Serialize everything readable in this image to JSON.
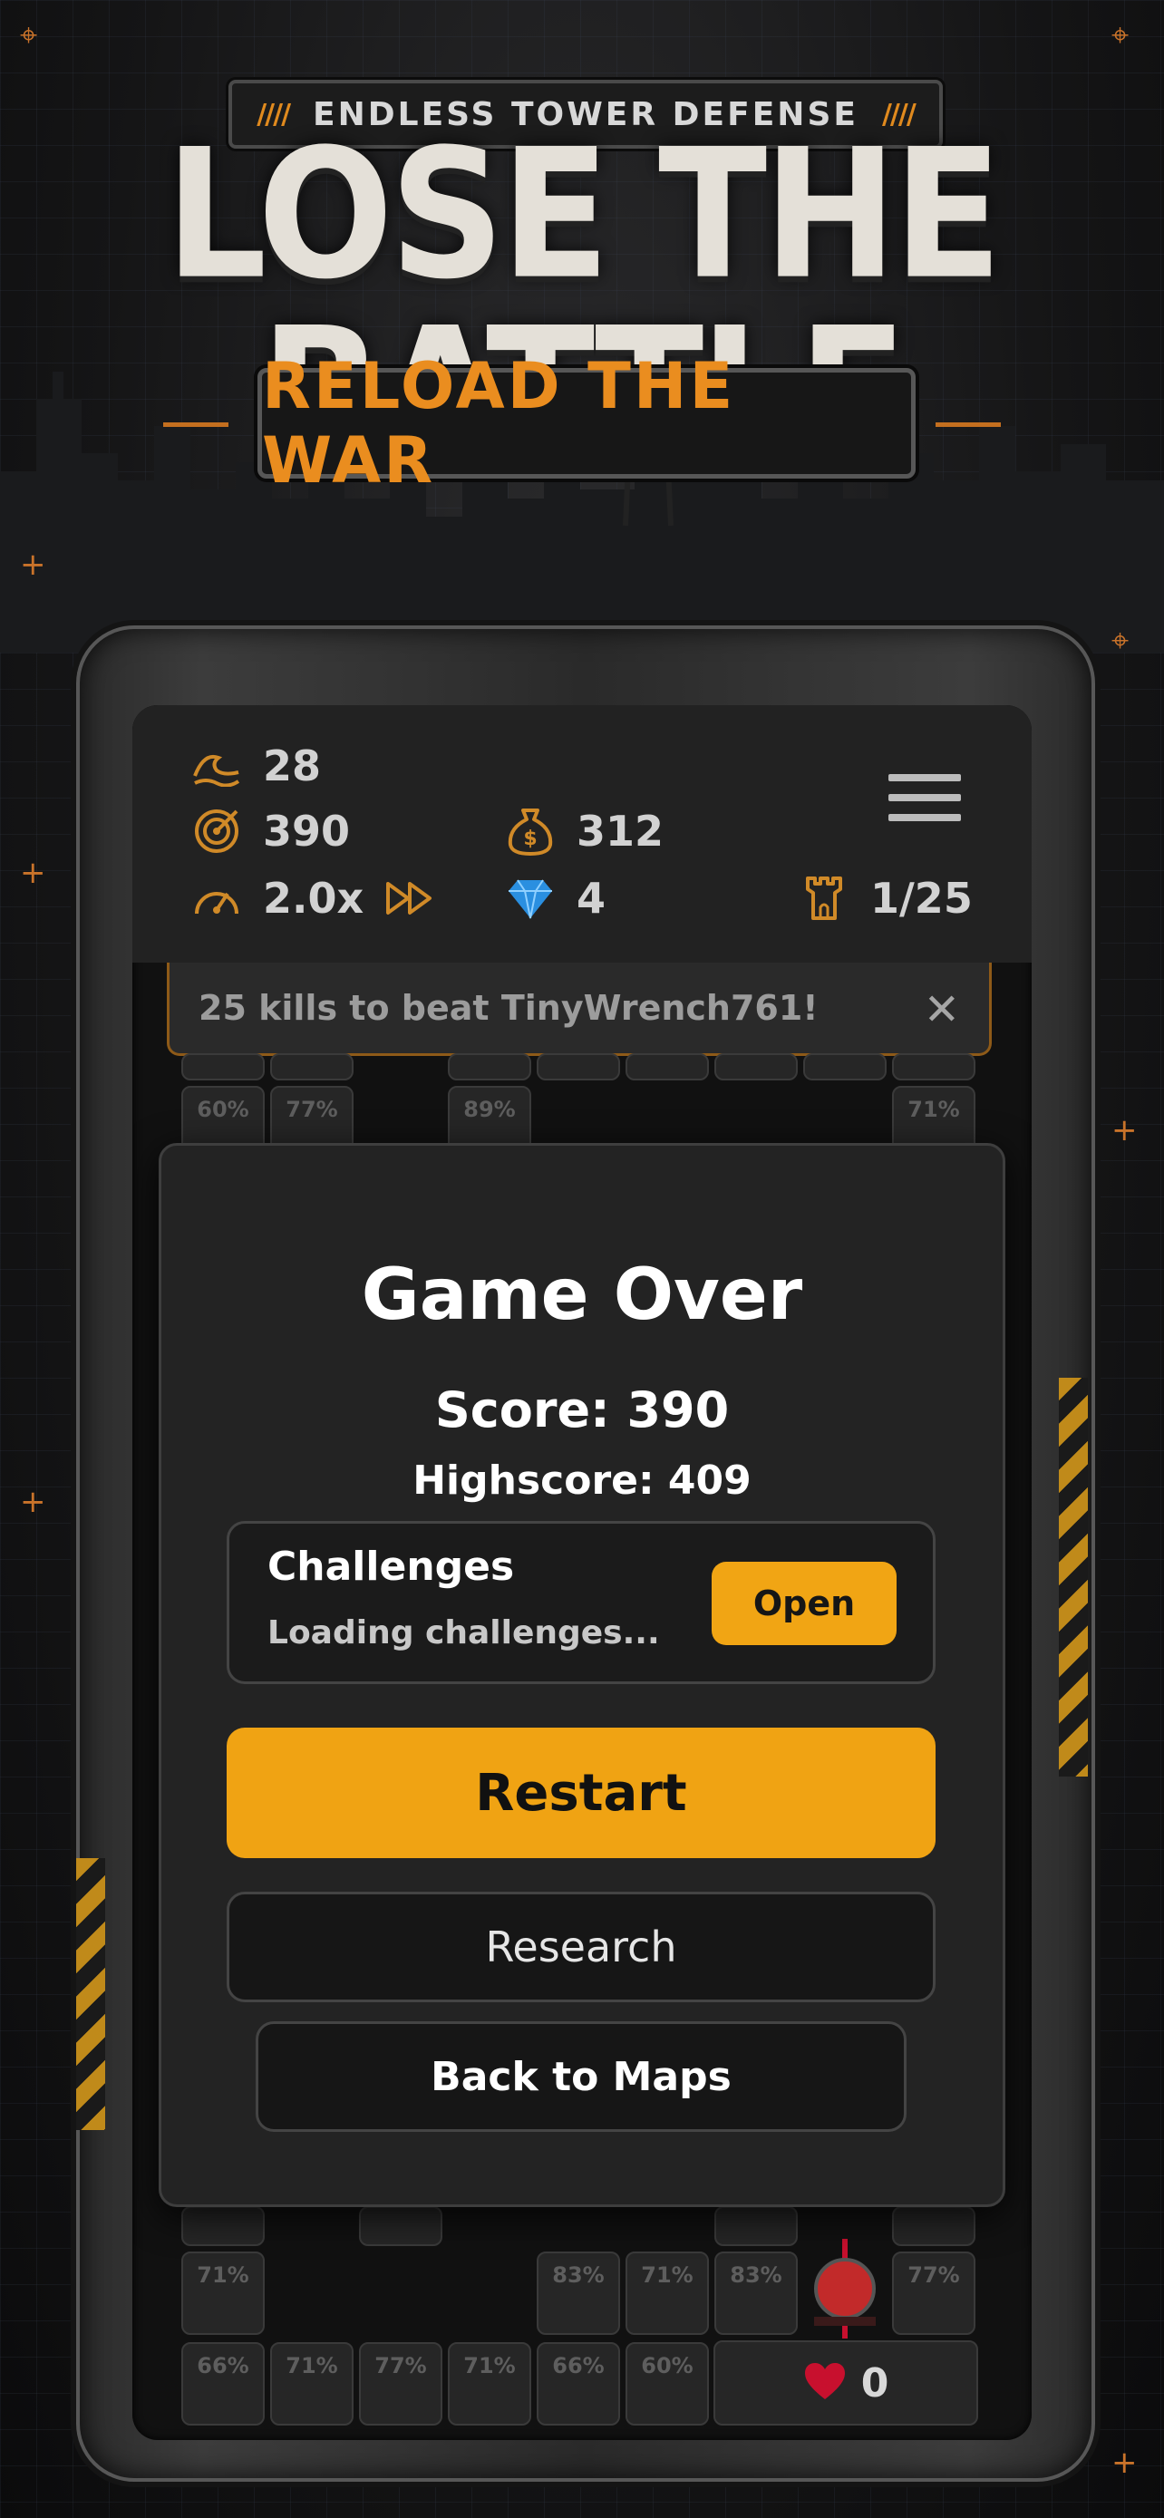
{
  "header": {
    "badge": "ENDLESS TOWER DEFENSE",
    "badge_stripes": "////",
    "title": "LOSE THE BATTLE",
    "subtitle": "RELOAD THE WAR"
  },
  "hud": {
    "wave": "28",
    "score": "390",
    "speed": "2.0x",
    "money": "312",
    "gems": "4",
    "towers": "1/25",
    "icons": [
      "wave-icon",
      "target-icon",
      "speedometer-icon",
      "fast-forward-icon",
      "money-bag-icon",
      "gem-icon",
      "tower-icon",
      "menu-icon"
    ]
  },
  "banner": {
    "text": "25 kills to beat TinyWrench761!",
    "close": "✕"
  },
  "grid": {
    "top_row_a": [
      "60%",
      "77%",
      "89%",
      "71%"
    ],
    "row_b": [
      "71%",
      "83%",
      "71%",
      "83%",
      "77%"
    ],
    "row_c": [
      "66%",
      "71%",
      "77%",
      "71%",
      "66%",
      "60%"
    ]
  },
  "modal": {
    "title": "Game Over",
    "score": "Score: 390",
    "highscore": "Highscore: 409",
    "challenges_title": "Challenges",
    "challenges_status": "Loading challenges...",
    "open_label": "Open",
    "restart_label": "Restart",
    "research_label": "Research",
    "back_label": "Back to Maps"
  },
  "lives": {
    "count": "0"
  },
  "colors": {
    "accent": "#f0a313",
    "orange": "#e08a1e",
    "gem": "#2a8fe0",
    "heart": "#c8102e"
  }
}
